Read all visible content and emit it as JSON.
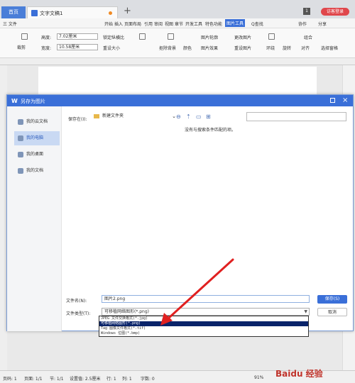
{
  "tabs": {
    "home": "首页",
    "doc": "文字文稿1",
    "badge": "1",
    "login": "访客登录"
  },
  "menu": {
    "file": "三 文件",
    "items": [
      "开始",
      "插入",
      "页面布局",
      "引用",
      "审阅",
      "视图",
      "章节",
      "开发工具",
      "特色功能"
    ],
    "active": "图片工具",
    "search": "Q查找",
    "collab": "协作",
    "share": "分享"
  },
  "ribbon": {
    "crop": "裁剪",
    "height_label": "高度:",
    "height_value": "7.02厘米",
    "width_label": "宽度:",
    "width_value": "10.58厘米",
    "lock_ratio": "锁定纵横比",
    "reset_size": "重设大小",
    "rotate": "旋转",
    "cutout": "抠除背景",
    "color": "颜色",
    "pic_outline": "图片轮廓",
    "pic_effect": "图片效果",
    "change_pic": "更改图片",
    "reset_pic": "重设图片",
    "wrap": "环绕",
    "rotate2": "旋转",
    "align": "对齐",
    "combine": "组合",
    "select_pane": "选择窗格"
  },
  "dialog": {
    "title": "另存为图片",
    "sidebar": [
      "我的云文档",
      "我的电脑",
      "我的桌面",
      "我的文档"
    ],
    "save_in_label": "保存在(I):",
    "folder": "新建文件夹",
    "empty_message": "没有与搜索条件匹配的项。",
    "filename_label": "文件名(N):",
    "filename_value": "图片2.png",
    "filetype_label": "文件类型(T):",
    "filetype_value": "可移植网络图形(*.png)",
    "save_button": "保存(S)",
    "cancel_button": "取消",
    "filetype_options": [
      "JPEG 文件交换格式(*.jpg)",
      "可移植网络图形(*.png)",
      "Tag 图像文件格式(*.tif)",
      "Windows 位图(*.bmp)"
    ],
    "selected_option_index": 1
  },
  "status": {
    "page": "页码: 1",
    "pages": "页面: 1/1",
    "section": "节: 1/1",
    "position": "设置值: 2.5厘米",
    "row": "行: 1",
    "col": "列: 1",
    "words": "字数: 0",
    "zoom": "91%"
  },
  "watermark": "Baidu 经验",
  "colors": {
    "accent": "#3a6fd8",
    "arrow": "#e02020",
    "login": "#e0474c"
  }
}
